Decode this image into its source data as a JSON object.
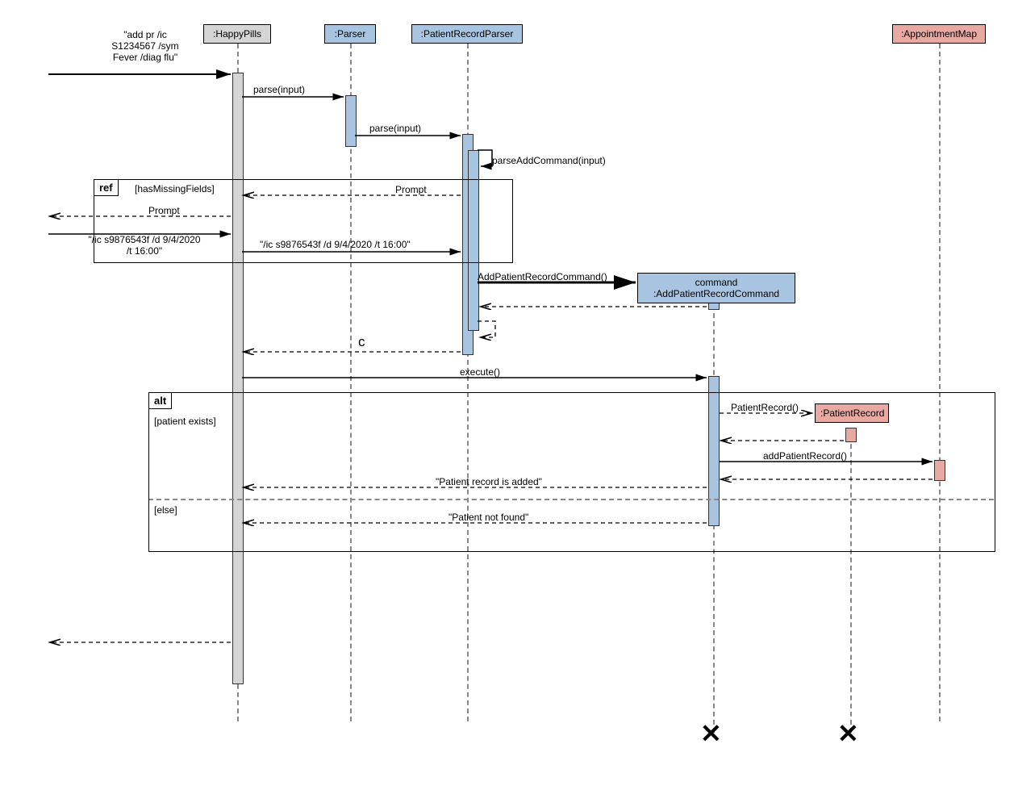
{
  "lifelines": {
    "happypills": ":HappyPills",
    "parser": ":Parser",
    "prparser": ":PatientRecordParser",
    "appmap": ":AppointmentMap",
    "command": "command\n:AddPatientRecordCommand",
    "patientrecord": ":PatientRecord"
  },
  "messages": {
    "input": "\"add pr /ic\nS1234567 /sym\nFever /diag flu\"",
    "parse1": "parse(input)",
    "parse2": "parse(input)",
    "parseadd": "parseAddCommand(input)",
    "prompt1": "Prompt",
    "prompt2": "Prompt",
    "resend": "\"/ic s9876543f /d 9/4/2020 /t 16:00\"",
    "resendshort": "\"/ic s9876543f /d 9/4/2020\n/t 16:00\"",
    "addprcmd": "AddPatientRecordCommand()",
    "c": "c",
    "execute": "execute()",
    "patientrec": "PatientRecord()",
    "addpr": "addPatientRecord()",
    "added": "\"Patient record is added\"",
    "notfound": "\"Patient not found\""
  },
  "fragments": {
    "ref": "ref",
    "ref_cond": "[hasMissingFields]",
    "alt": "alt",
    "alt_if": "[patient exists]",
    "alt_else": "[else]"
  }
}
